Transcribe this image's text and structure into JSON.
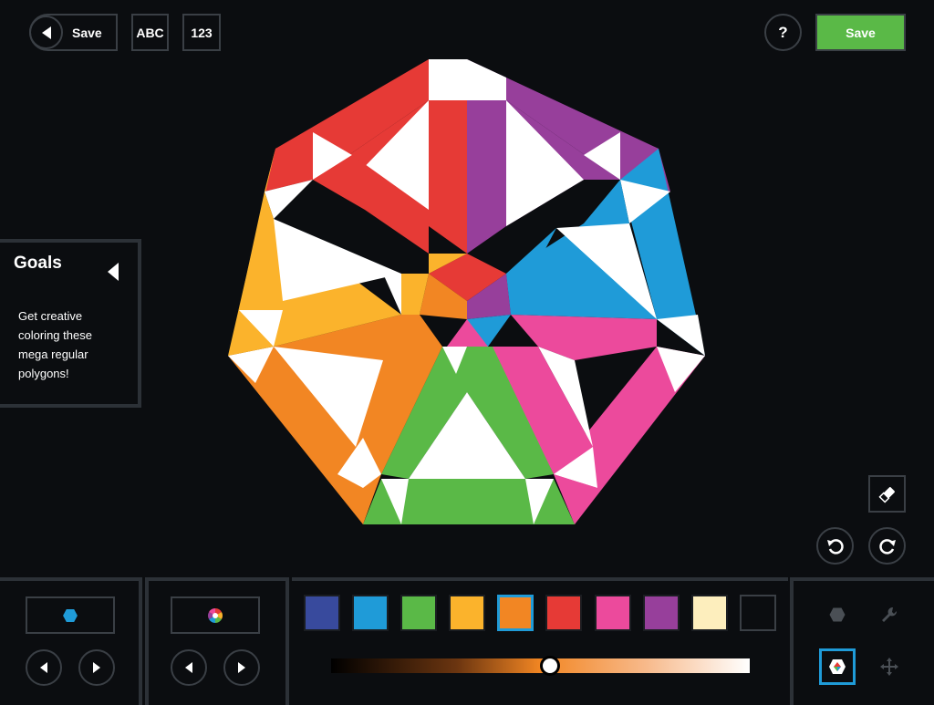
{
  "topbar": {
    "back_save_label": "Save",
    "abc_label": "ABC",
    "num_label": "123",
    "help_label": "?",
    "save_label": "Save"
  },
  "goals": {
    "title": "Goals",
    "text": "Get creative coloring these mega regular polygons!"
  },
  "palette": {
    "colors": [
      "#384a9d",
      "#1f9bd8",
      "#5ab947",
      "#fbb32c",
      "#f28623",
      "#e63a36",
      "#ec4a9c",
      "#973f9b",
      "#fdeebd",
      "#0b0d10"
    ],
    "selected_index": 4
  },
  "shade_slider": {
    "value": 0.5
  },
  "colors": {
    "red": "#e63a36",
    "purple": "#973f9b",
    "blue": "#1f9bd8",
    "pink": "#ec4a9c",
    "green": "#5ab947",
    "orange": "#f28623",
    "yellow": "#fbb32c",
    "white": "#ffffff",
    "accent_green": "#5ab947",
    "accent_blue": "#1f9bd8"
  }
}
